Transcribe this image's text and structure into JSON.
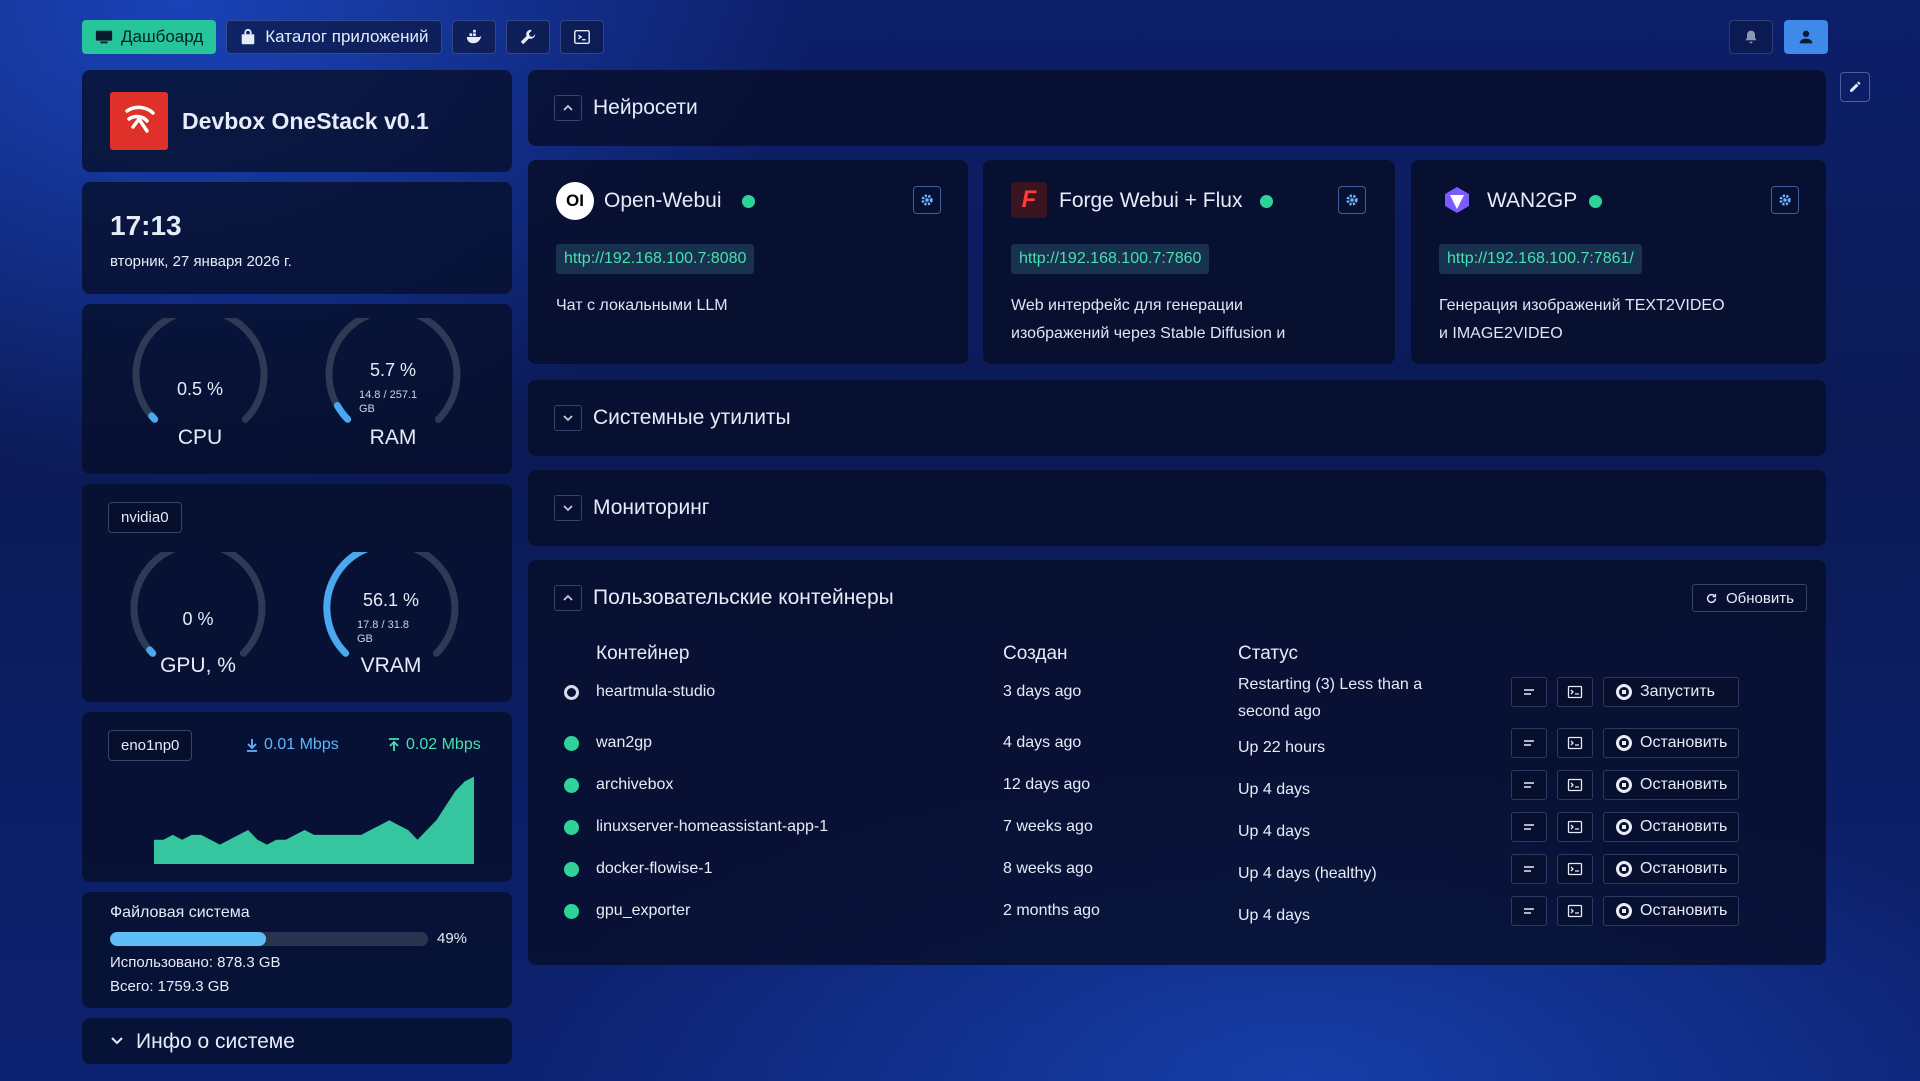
{
  "nav": {
    "dashboard": "Дашбоард",
    "catalog": "Каталог приложений"
  },
  "brand": {
    "title": "Devbox OneStack v0.1"
  },
  "clock": {
    "time": "17:13",
    "date": "вторник, 27 января 2026 г."
  },
  "cpu": {
    "label": "CPU",
    "value_text": "0.5 %",
    "value": 0.5
  },
  "ram": {
    "label": "RAM",
    "value_text": "5.7 %",
    "detail1": "14.8 / 257.1",
    "detail2": "GB",
    "value": 5.7
  },
  "gpu_device": "nvidia0",
  "gpu": {
    "label": "GPU, %",
    "value_text": "0 %",
    "value": 0
  },
  "vram": {
    "label": "VRAM",
    "value_text": "56.1 %",
    "detail1": "17.8 / 31.8",
    "detail2": "GB",
    "value": 56.1
  },
  "network": {
    "iface": "eno1np0",
    "down": "0.01 Mbps",
    "up": "0.02 Mbps",
    "series": [
      5,
      5,
      6,
      5,
      6,
      6,
      5,
      4,
      5,
      6,
      7,
      5,
      4,
      5,
      5,
      6,
      7,
      6,
      6,
      6,
      6,
      6,
      6,
      7,
      8,
      9,
      8,
      7,
      5,
      7,
      9,
      12,
      15,
      17,
      18
    ]
  },
  "filesystem": {
    "title": "Файловая система",
    "percent_text": "49%",
    "percent": 49,
    "used": "Использовано: 878.3 GB",
    "total": "Всего: 1759.3 GB"
  },
  "sysinfo": {
    "label": "Инфо о системе"
  },
  "sections": {
    "ai": "Нейросети",
    "utils": "Системные утилиты",
    "monitoring": "Мониторинг",
    "containers": "Пользовательские контейнеры"
  },
  "apps": [
    {
      "name": "Open-Webui",
      "url": "http://192.168.100.7:8080",
      "desc": "Чат с локальными LLM",
      "logo": "OI"
    },
    {
      "name": "Forge Webui + Flux",
      "url": "http://192.168.100.7:7860",
      "desc_l1": "Web интерфейс для генерации",
      "desc_l2": "изображений через Stable Diffusion и",
      "logo": "F"
    },
    {
      "name": "WAN2GP",
      "url": "http://192.168.100.7:7861/",
      "desc_l1": "Генерация изображений TEXT2VIDEO",
      "desc_l2": "и IMAGE2VIDEO"
    }
  ],
  "containers": {
    "refresh": "Обновить",
    "headers": [
      "Контейнер",
      "Создан",
      "Статус"
    ],
    "rows": [
      {
        "name": "heartmula-studio",
        "created": "3 days ago",
        "status_l1": "Restarting (3) Less than a",
        "status_l2": "second ago",
        "action": "Запустить",
        "state": "restarting"
      },
      {
        "name": "wan2gp",
        "created": "4 days ago",
        "status_l1": "Up 22 hours",
        "action": "Остановить",
        "state": "up"
      },
      {
        "name": "archivebox",
        "created": "12 days ago",
        "status_l1": "Up 4 days",
        "action": "Остановить",
        "state": "up"
      },
      {
        "name": "linuxserver-homeassistant-app-1",
        "created": "7 weeks ago",
        "status_l1": "Up 4 days",
        "action": "Остановить",
        "state": "up"
      },
      {
        "name": "docker-flowise-1",
        "created": "8 weeks ago",
        "status_l1": "Up 4 days (healthy)",
        "action": "Остановить",
        "state": "up"
      },
      {
        "name": "gpu_exporter",
        "created": "2 months ago",
        "status_l1": "Up 4 days",
        "action": "Остановить",
        "state": "up"
      }
    ]
  },
  "colors": {
    "accent": "#27c69a",
    "status_ok": "#2fd39a",
    "gauge": "#4aa8f0",
    "panel": "#070e28"
  }
}
